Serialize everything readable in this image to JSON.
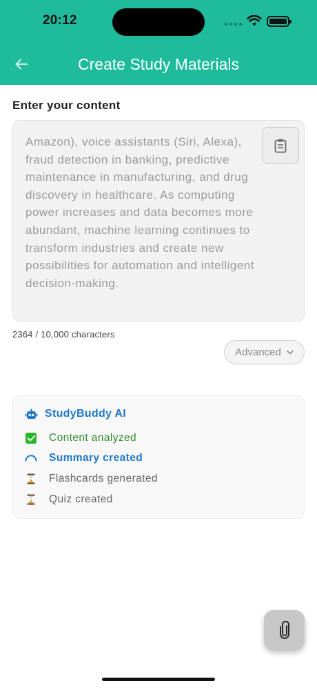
{
  "status_bar": {
    "time": "20:12"
  },
  "header": {
    "title": "Create Study Materials",
    "back_icon": "arrow-left-icon"
  },
  "content": {
    "label": "Enter your content",
    "text": "Amazon), voice assistants (Siri, Alexa), fraud detection in banking, predictive maintenance in manufacturing, and drug discovery in healthcare. As computing power increases and data becomes more abundant, machine learning continues to transform industries and create new possibilities for automation and intelligent decision-making.",
    "paste_icon": "clipboard-icon",
    "char_count": "2364 / 10,000 characters"
  },
  "advanced": {
    "label": "Advanced",
    "icon": "chevron-down-icon"
  },
  "ai_panel": {
    "title": "StudyBuddy AI",
    "icon": "robot-icon",
    "steps": [
      {
        "label": "Content analyzed",
        "state": "done",
        "icon": "check-icon"
      },
      {
        "label": "Summary created",
        "state": "in-progress",
        "icon": "spinner-icon"
      },
      {
        "label": "Flashcards generated",
        "state": "pending",
        "icon": "hourglass-icon"
      },
      {
        "label": "Quiz created",
        "state": "pending",
        "icon": "hourglass-icon"
      }
    ]
  },
  "fab": {
    "icon": "paperclip-icon"
  },
  "colors": {
    "accent": "#1ebc9c",
    "blue": "#1f78c8",
    "green": "#2e8b2e"
  }
}
